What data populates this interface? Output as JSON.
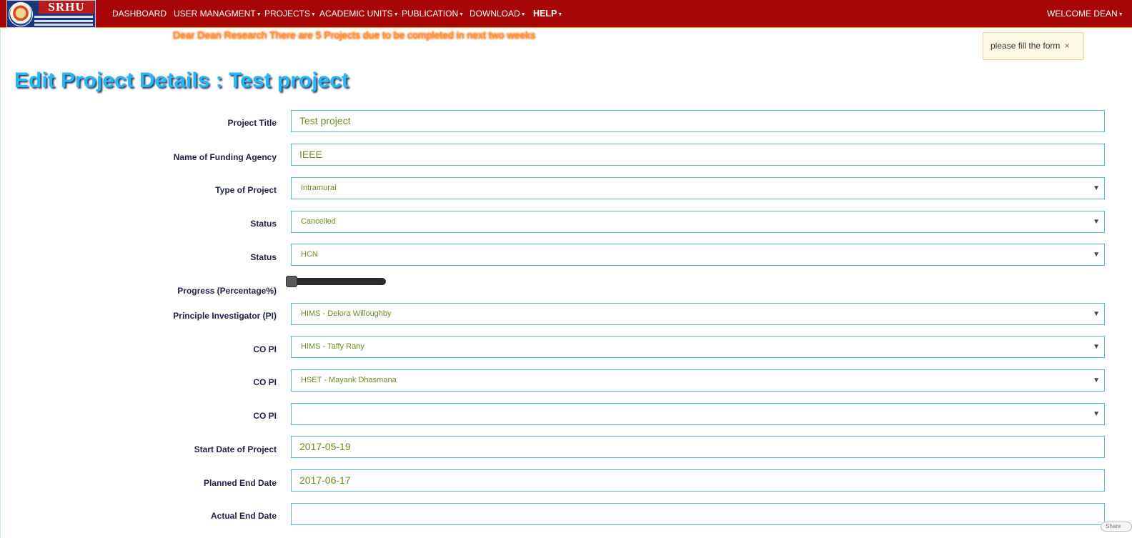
{
  "brand": {
    "logo_text": "SRHU"
  },
  "nav": {
    "items": [
      {
        "label": "DASHBOARD",
        "caret": false
      },
      {
        "label": "USER MANAGMENT",
        "caret": true
      },
      {
        "label": "PROJECTS",
        "caret": true
      },
      {
        "label": "ACADEMIC UNITS",
        "caret": true
      },
      {
        "label": "PUBLICATION",
        "caret": true
      },
      {
        "label": "DOWNLOAD",
        "caret": true
      },
      {
        "label": "HELP",
        "caret": true
      }
    ],
    "welcome": "WELCOME DEAN"
  },
  "notice": "Dear Dean Research There are 5 Projects due to be completed in next two weeks",
  "toast": {
    "message": "please fill the form",
    "close": "×"
  },
  "page_title": "Edit Project Details : Test project",
  "form": {
    "project_title": {
      "label": "Project Title",
      "value": "Test project"
    },
    "funding_agency": {
      "label": "Name of Funding Agency",
      "value": "IEEE"
    },
    "project_type": {
      "label": "Type of Project",
      "value": "Intramural"
    },
    "status": {
      "label": "Status",
      "value": "Cancelled"
    },
    "status2": {
      "label": "Status",
      "value": "HCN"
    },
    "progress": {
      "label": "Progress (Percentage%)",
      "value_percent": 0
    },
    "pi": {
      "label": "Principle Investigator (PI)",
      "value": "HIMS - Delora Willoughby"
    },
    "co_pi_1": {
      "label": "CO PI",
      "value": "HIMS - Taffy Rany"
    },
    "co_pi_2": {
      "label": "CO PI",
      "value": "HSET - Mayank Dhasmana"
    },
    "co_pi_3": {
      "label": "CO PI",
      "value": ""
    },
    "start_date": {
      "label": "Start Date of Project",
      "value": "2017-05-19"
    },
    "planned_end": {
      "label": "Planned End Date",
      "value": "2017-06-17"
    },
    "actual_end": {
      "label": "Actual End Date",
      "value": ""
    }
  },
  "select_arrow": "▼",
  "share": "Share",
  "colors": {
    "navbar": "#a80606",
    "title": "#29b6f6",
    "field_text": "#6b8e23",
    "field_border": "#5ab6d9",
    "notice": "#f5a623"
  }
}
